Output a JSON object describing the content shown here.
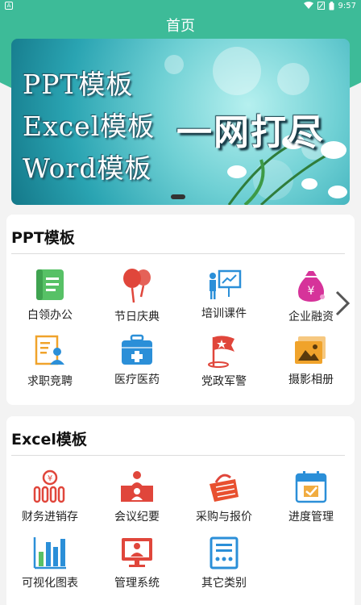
{
  "status_bar": {
    "left_icon": "notification-a-icon",
    "time": "9:57",
    "icons": [
      "wifi-icon",
      "sim-icon",
      "battery-icon"
    ]
  },
  "header": {
    "title": "首页"
  },
  "banner": {
    "lines": [
      "PPT模板",
      "Excel模板",
      "Word模板"
    ],
    "slogan": "一网打尽"
  },
  "colors": {
    "primary": "#3dbb98",
    "ppt_green": "#57c166",
    "red": "#e0463b",
    "blue": "#2b8fd8",
    "orange": "#f0a32b"
  },
  "ppt_section": {
    "title": "PPT模板",
    "items": [
      {
        "label": "白领办公",
        "icon": "notebook-icon"
      },
      {
        "label": "节日庆典",
        "icon": "balloon-icon"
      },
      {
        "label": "培训课件",
        "icon": "presentation-board-icon"
      },
      {
        "label": "企业融资",
        "icon": "money-bag-icon"
      },
      {
        "label": "求职竞聘",
        "icon": "resume-icon"
      },
      {
        "label": "医疗医药",
        "icon": "medical-kit-icon"
      },
      {
        "label": "党政军警",
        "icon": "flag-star-icon"
      },
      {
        "label": "摄影相册",
        "icon": "photo-album-icon"
      }
    ]
  },
  "excel_section": {
    "title": "Excel模板",
    "items": [
      {
        "label": "财务进销存",
        "icon": "finance-coin-icon"
      },
      {
        "label": "会议纪要",
        "icon": "meeting-icon"
      },
      {
        "label": "采购与报价",
        "icon": "shopping-basket-icon"
      },
      {
        "label": "进度管理",
        "icon": "calendar-check-icon"
      },
      {
        "label": "可视化图表",
        "icon": "bar-chart-icon"
      },
      {
        "label": "管理系统",
        "icon": "monitor-user-icon"
      },
      {
        "label": "其它类别",
        "icon": "document-list-icon"
      }
    ]
  }
}
